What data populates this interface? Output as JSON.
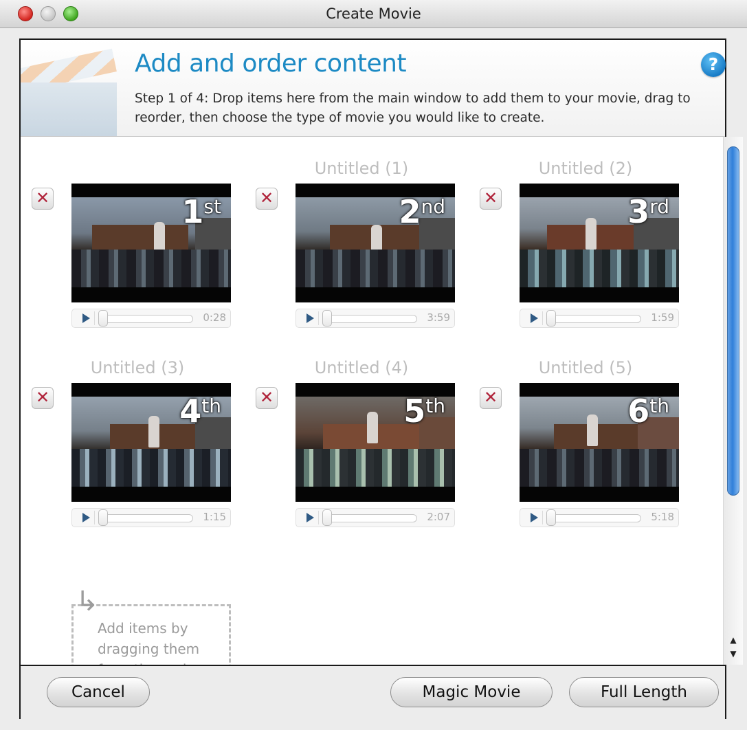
{
  "window": {
    "title": "Create Movie"
  },
  "header": {
    "title": "Add and order content",
    "description": "Step 1 of 4: Drop items here from the main window to add them to your movie, drag to reorder, then choose the type of movie you would like to create.",
    "help_glyph": "?"
  },
  "items": [
    {
      "title": "",
      "rank": "1",
      "suffix": "st",
      "duration": "0:28"
    },
    {
      "title": "Untitled (1)",
      "rank": "2",
      "suffix": "nd",
      "duration": "3:59"
    },
    {
      "title": "Untitled (2)",
      "rank": "3",
      "suffix": "rd",
      "duration": "1:59"
    },
    {
      "title": "Untitled (3)",
      "rank": "4",
      "suffix": "th",
      "duration": "1:15"
    },
    {
      "title": "Untitled (4)",
      "rank": "5",
      "suffix": "th",
      "duration": "2:07"
    },
    {
      "title": "Untitled (5)",
      "rank": "6",
      "suffix": "th",
      "duration": "5:18"
    }
  ],
  "dropzone": {
    "text": "Add items by dragging them from the main"
  },
  "buttons": {
    "cancel": "Cancel",
    "magic_movie": "Magic Movie",
    "full_length": "Full Length"
  }
}
